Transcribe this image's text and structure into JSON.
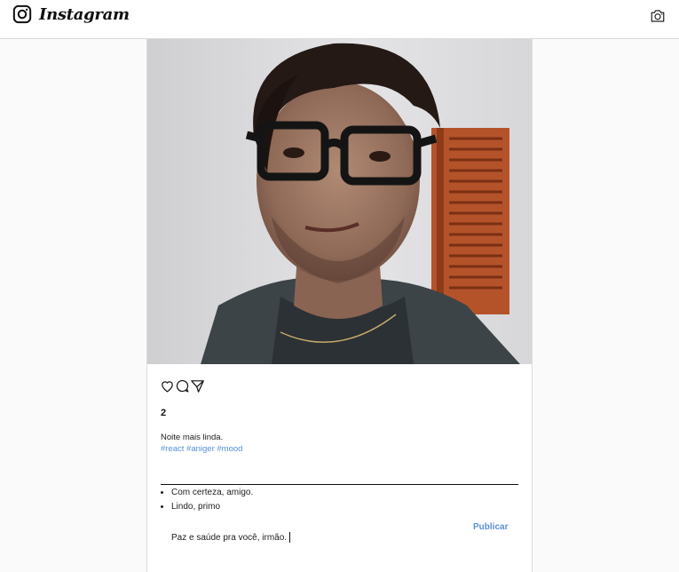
{
  "header": {
    "brand_name": "Instagram",
    "logo_icon": "instagram-glyph-icon",
    "camera_icon": "camera-icon"
  },
  "post": {
    "photo_description_icon": "selfie-photo",
    "actions": [
      {
        "name": "like",
        "icon": "heart-outline-icon"
      },
      {
        "name": "comment",
        "icon": "comment-bubble-icon"
      },
      {
        "name": "share",
        "icon": "paper-plane-icon"
      }
    ],
    "likes_count": "2",
    "caption": "Noite mais linda.",
    "hashtags": [
      "#react",
      "#aniger",
      "#mood"
    ],
    "comments": [
      "Com certeza, amigo.",
      "Lindo, primo"
    ],
    "publish_label": "Publicar",
    "comment_input_value": "Paz e saúde pra você, irmão."
  },
  "colors": {
    "hashtag": "#5a8fd8",
    "publish": "#5b8fd6",
    "border": "#dbdbdb"
  }
}
